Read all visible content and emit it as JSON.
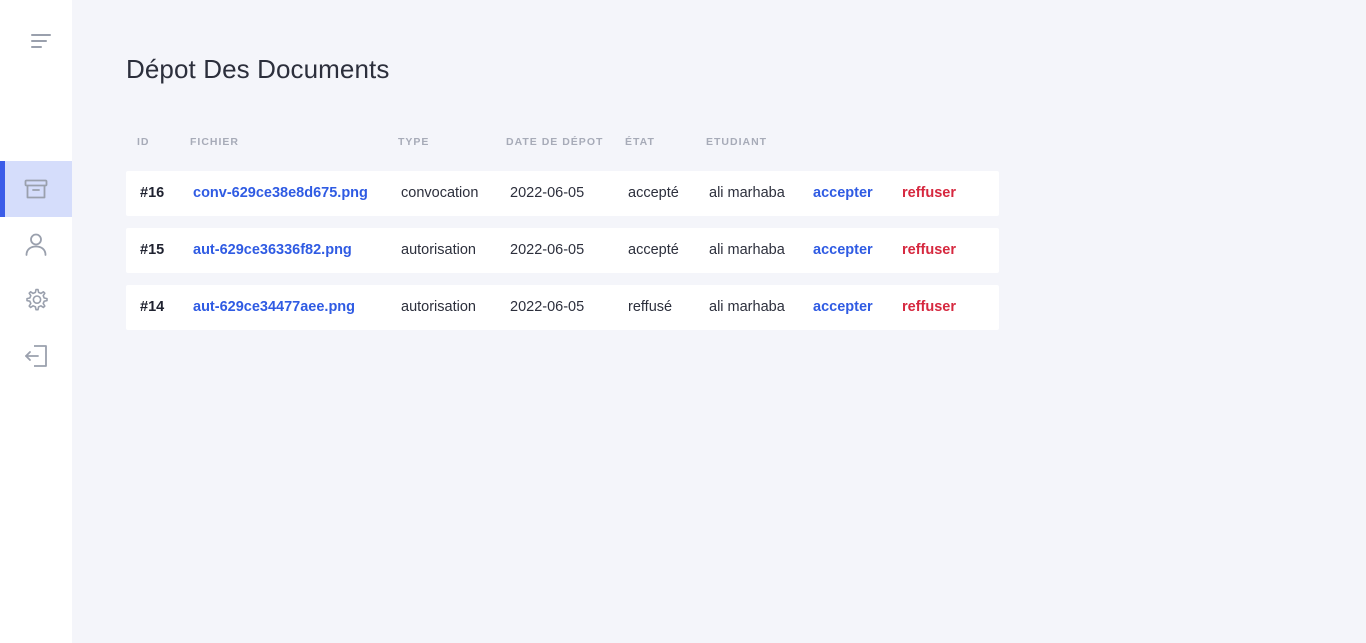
{
  "sidebar": {
    "items": [
      {
        "name": "archive",
        "icon": "archive-icon",
        "active": true
      },
      {
        "name": "user",
        "icon": "user-icon",
        "active": false
      },
      {
        "name": "settings",
        "icon": "gear-icon",
        "active": false
      },
      {
        "name": "logout",
        "icon": "logout-icon",
        "active": false
      }
    ]
  },
  "page": {
    "title": "Dépot Des Documents"
  },
  "table": {
    "headers": [
      "ID",
      "FICHIER",
      "TYPE",
      "DATE DE DÉPOT",
      "ÉTAT",
      "ETUDIANT"
    ],
    "rows": [
      {
        "id": "#16",
        "file": "conv-629ce38e8d675.png",
        "type": "convocation",
        "date": "2022-06-05",
        "state": "accepté",
        "student": "ali marhaba",
        "accept": "accepter",
        "refuse": "reffuser"
      },
      {
        "id": "#15",
        "file": "aut-629ce36336f82.png",
        "type": "autorisation",
        "date": "2022-06-05",
        "state": "accepté",
        "student": "ali marhaba",
        "accept": "accepter",
        "refuse": "reffuser"
      },
      {
        "id": "#14",
        "file": "aut-629ce34477aee.png",
        "type": "autorisation",
        "date": "2022-06-05",
        "state": "reffusé",
        "student": "ali marhaba",
        "accept": "accepter",
        "refuse": "reffuser"
      }
    ]
  },
  "colors": {
    "accent": "#2f5be3",
    "danger": "#d6283f",
    "active_bg": "#d5ddfb",
    "background": "#f4f5fa"
  }
}
